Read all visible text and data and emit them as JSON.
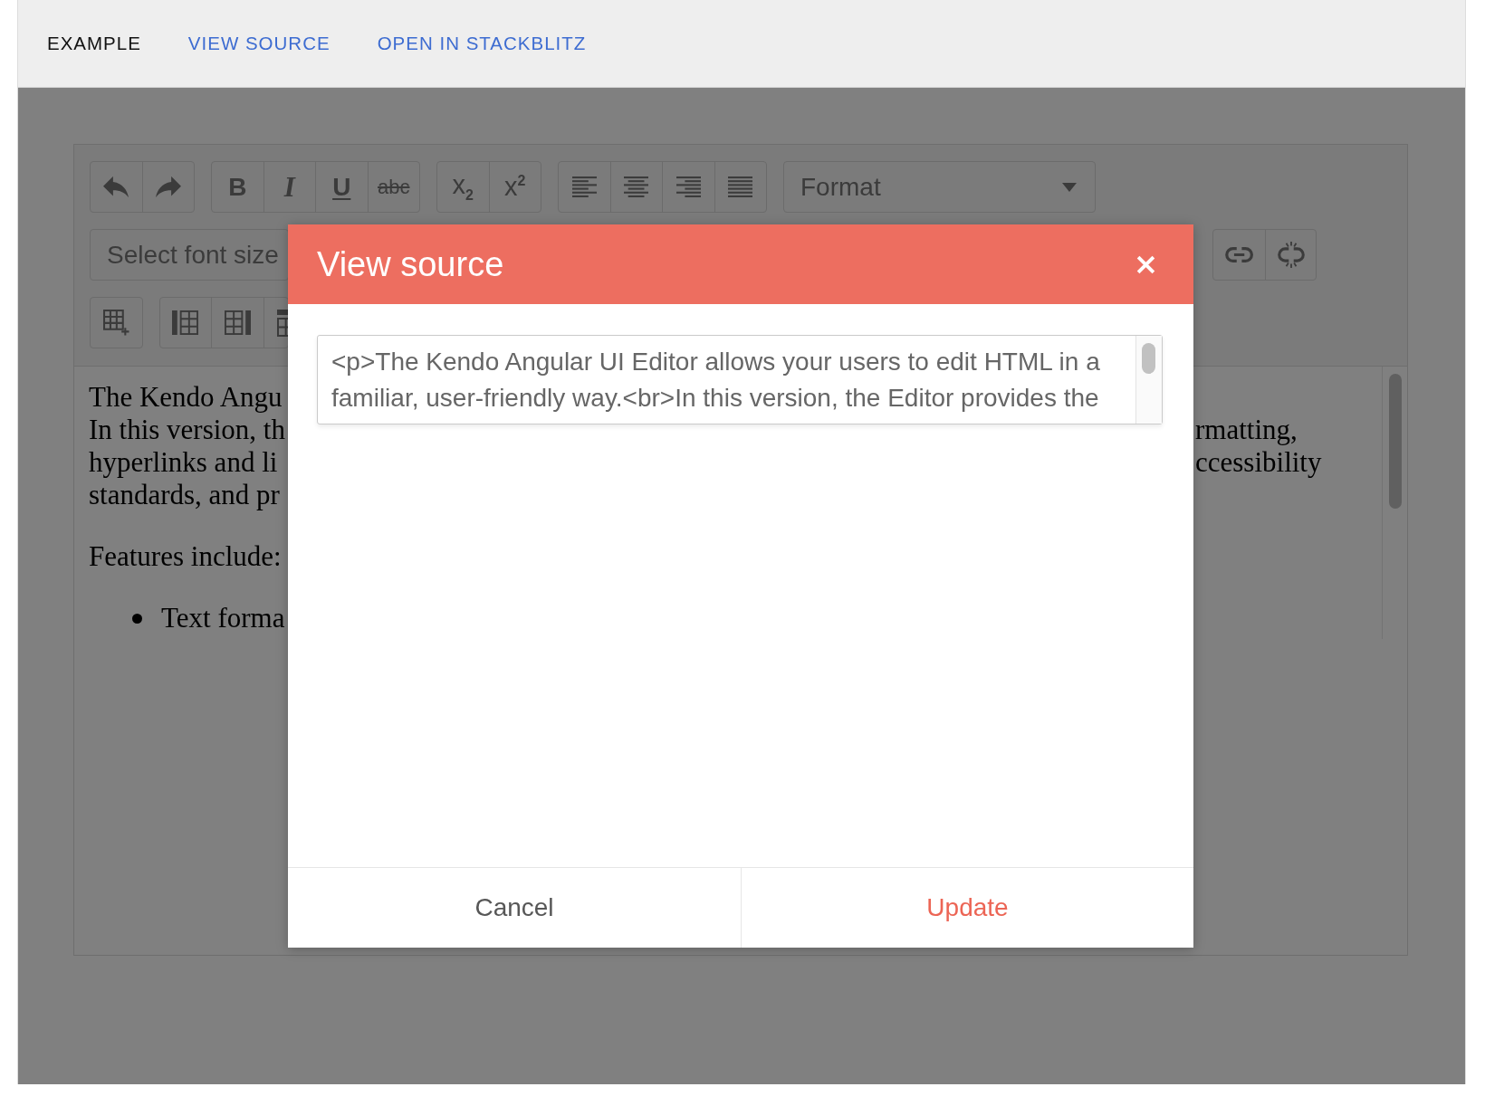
{
  "tabs": [
    {
      "label": "EXAMPLE",
      "selected": true
    },
    {
      "label": "VIEW SOURCE",
      "selected": false
    },
    {
      "label": "OPEN IN STACKBLITZ",
      "selected": false
    }
  ],
  "editor": {
    "toolbar": {
      "rows": [
        {
          "items": [
            {
              "kind": "group",
              "tools": [
                {
                  "kind": "undo"
                },
                {
                  "kind": "redo"
                }
              ]
            },
            {
              "kind": "group",
              "tools": [
                {
                  "kind": "bold",
                  "label": "B"
                },
                {
                  "kind": "italic",
                  "label": "I"
                },
                {
                  "kind": "underline",
                  "label": "U"
                },
                {
                  "kind": "strikethrough",
                  "label": "abc"
                }
              ]
            },
            {
              "kind": "group",
              "tools": [
                {
                  "kind": "subscript",
                  "label": "x$_{2}$"
                },
                {
                  "kind": "superscript",
                  "label": "x$^{2}$"
                }
              ]
            },
            {
              "kind": "group",
              "tools": [
                {
                  "kind": "align-left"
                },
                {
                  "kind": "align-center"
                },
                {
                  "kind": "align-right"
                },
                {
                  "kind": "align-justify"
                }
              ]
            },
            {
              "kind": "dropdown",
              "placeholder": "Format",
              "caret": true
            }
          ]
        },
        {
          "items": [
            {
              "kind": "dropdown",
              "placeholder": "Select font size"
            },
            {
              "kind": "group",
              "tools": [
                {
                  "kind": "link"
                },
                {
                  "kind": "unlink"
                }
              ]
            }
          ]
        },
        {
          "items": [
            {
              "kind": "group",
              "tools": [
                {
                  "kind": "insert-table"
                }
              ]
            },
            {
              "kind": "group",
              "tools": [
                {
                  "kind": "add-column-left"
                },
                {
                  "kind": "add-column-right"
                },
                {
                  "kind": "add-row-above"
                }
              ]
            }
          ]
        }
      ]
    },
    "content": {
      "paragraphs": [
        {
          "lines": [
            [
              "The Kendo Angu"
            ],
            [
              "In this version, th",
              "rmatting,"
            ],
            [
              "hyperlinks and li",
              "ccessibility"
            ],
            [
              "standards, and pr"
            ]
          ]
        },
        {
          "lines": [
            [
              "Features include:"
            ]
          ]
        }
      ],
      "list_items": [
        {
          "lines": [
            [
              "Text forma"
            ]
          ]
        }
      ]
    }
  },
  "dialog": {
    "title": "View source",
    "source": {
      "value": "<p>The Kendo Angular UI Editor allows your users to edit HTML in a familiar, user-friendly way.<br>In this version, the Editor provides the"
    },
    "buttons": [
      {
        "kind": "cancel",
        "label": "Cancel"
      },
      {
        "kind": "update",
        "label": "Update"
      }
    ]
  }
}
